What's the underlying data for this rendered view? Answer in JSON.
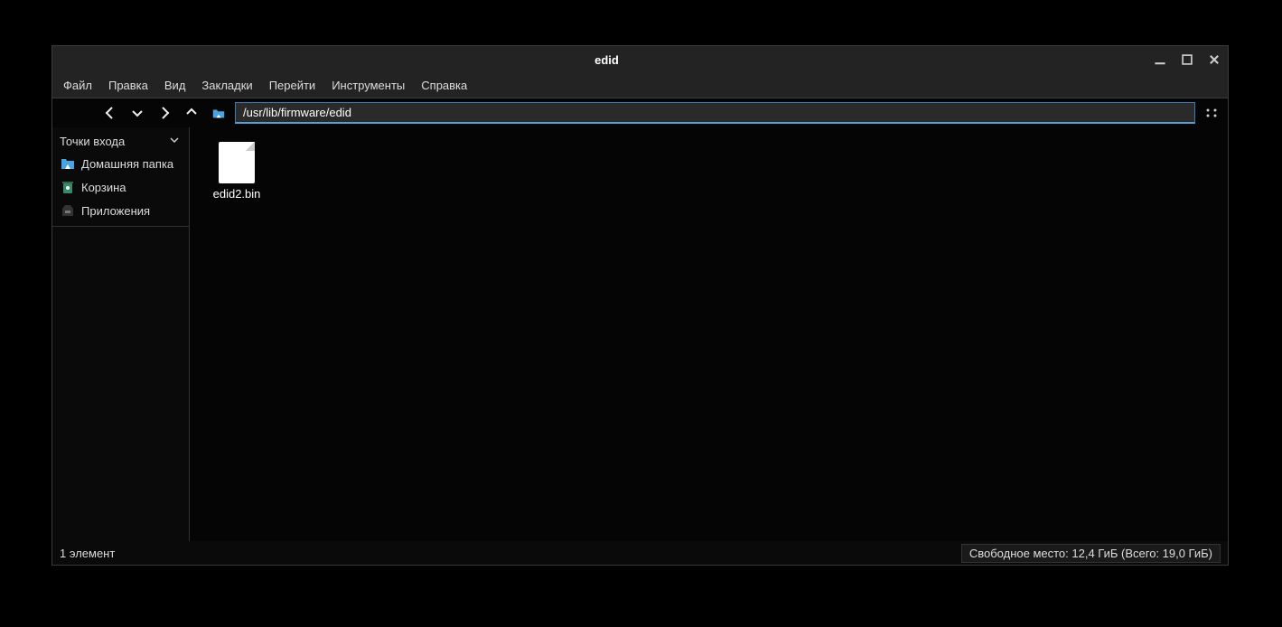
{
  "window": {
    "title": "edid"
  },
  "menu": {
    "file": "Файл",
    "edit": "Правка",
    "view": "Вид",
    "bookmarks": "Закладки",
    "go": "Перейти",
    "tools": "Инструменты",
    "help": "Справка"
  },
  "toolbar": {
    "path": "/usr/lib/firmware/edid"
  },
  "sidebar": {
    "header": "Точки входа",
    "items": {
      "home": "Домашняя папка",
      "trash": "Корзина",
      "apps": "Приложения"
    }
  },
  "files": [
    {
      "name": "edid2.bin"
    }
  ],
  "status": {
    "left": "1 элемент",
    "right": "Свободное место: 12,4 ГиБ (Всего: 19,0 ГиБ)"
  }
}
